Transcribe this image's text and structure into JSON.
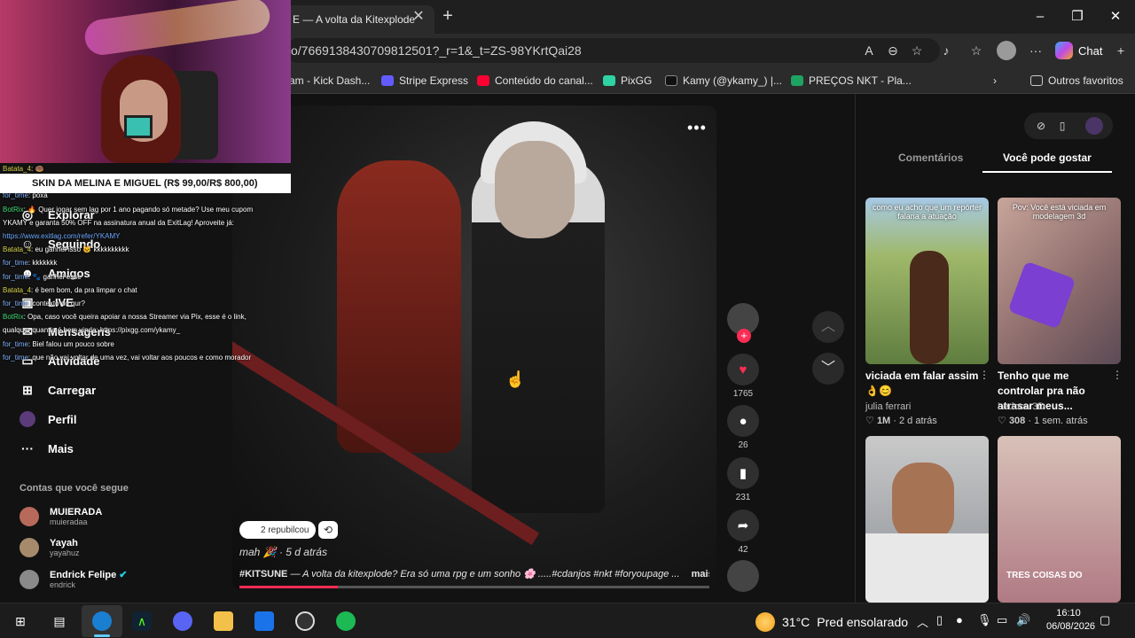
{
  "browser": {
    "tab_title": "E — A volta da Kitexplode",
    "tab_close": "✕",
    "new_tab": "+",
    "address": "o/7669138430709812501?_r=1&_t=ZS-98YKrtQai28",
    "chat_label": "Chat",
    "bookmarks": [
      "am - Kick Dash...",
      "Stripe Express",
      "Conteúdo do canal...",
      "PixGG",
      "Kamy (@ykamy_) |...",
      "PREÇOS NKT - Pla..."
    ],
    "other_favorites": "Outros favoritos",
    "colors": {
      "bar": "#2b2b2b",
      "tab_bar": "#1f1f1f"
    }
  },
  "sidebar": {
    "items": [
      {
        "label": "Explorar",
        "icon": "compass-icon"
      },
      {
        "label": "Seguindo",
        "icon": "following-icon"
      },
      {
        "label": "Amigos",
        "icon": "friends-icon"
      },
      {
        "label": "LIVE",
        "icon": "live-icon"
      },
      {
        "label": "Mensagens",
        "icon": "messages-icon"
      },
      {
        "label": "Atividade",
        "icon": "activity-icon"
      },
      {
        "label": "Carregar",
        "icon": "upload-icon"
      },
      {
        "label": "Perfil",
        "icon": "profile-icon"
      },
      {
        "label": "Mais",
        "icon": "more-icon"
      }
    ],
    "following_header": "Contas que você segue",
    "accounts": [
      {
        "name": "MUIERADA",
        "handle": "muieradaa"
      },
      {
        "name": "Yayah",
        "handle": "yayahuz"
      },
      {
        "name": "Endrick Felipe",
        "handle": "endrick"
      }
    ]
  },
  "video": {
    "repost_text": "2 repubilcou",
    "author": "mah 🎉 · 5 d atrás",
    "caption_bold": "#KITSUNE",
    "caption": " — A volta da kitexplode? Era só uma rpg e um sonho 🌸 .....#cdanjos #nkt #foryoupage ...",
    "more_label": "mais",
    "progress": 0.21,
    "likes": "1765",
    "comments": "26",
    "saves": "231",
    "shares": "42"
  },
  "right_panel": {
    "tabs": [
      "Comentários",
      "Você pode gostar"
    ],
    "active_tab": "Você pode gostar",
    "cards": [
      {
        "overlay": "como eu acho que um repórter falaria a atuação",
        "title": "viciada em falar assim 👌😊",
        "author": "julia ferrari",
        "likes": "1M",
        "time": "2 d atrás",
        "bg": "#5f7d3f"
      },
      {
        "overlay": "Pov: Você está viciada em modelagem 3d",
        "title": "Tenho que me controlar pra não atrasar meus...",
        "author": "Ledoca 3D",
        "likes": "308",
        "time": "1 sem. atrás",
        "bg": "#8a6a6a"
      },
      {
        "overlay": "",
        "title": "",
        "author": "",
        "likes": "",
        "time": "",
        "bg": "#8a8f96"
      },
      {
        "overlay": "TRES COISAS DO",
        "title": "",
        "author": "",
        "likes": "",
        "time": "",
        "bg": "#b07a84"
      }
    ]
  },
  "stream": {
    "banner": "SKIN DA MELINA E MIGUEL (R$ 99,00/R$ 800,00)",
    "chat": [
      {
        "user": "Batata_4",
        "text": ": 🍩",
        "color": "g"
      },
      {
        "user": "for_time",
        "text": ": figurinha*",
        "color": "b"
      },
      {
        "user": "for_time",
        "text": ": poxa",
        "color": "b"
      },
      {
        "user": "BotRix",
        "text": ": 🔥 Quer jogar sem lag por 1 ano pagando só metade? Use meu cupom",
        "color": "gr"
      },
      {
        "user": "",
        "text": "YKAMY e garanta 50% OFF na assinatura anual da ExitLag! Aproveite já:",
        "color": ""
      },
      {
        "user": "",
        "text": "https://www.exitlag.com/refer/YKAMY",
        "color": "link"
      },
      {
        "user": "Batata_4",
        "text": ": eu ganhei isso 😺 kkkkkkkkkk",
        "color": "g"
      },
      {
        "user": "for_time",
        "text": ": kkkkkkk",
        "color": "b"
      },
      {
        "user": "for_time",
        "text": ": 🐾 ganhei esse",
        "color": "b"
      },
      {
        "user": "Batata_4",
        "text": ": é bem bom, da pra limpar o chat",
        "color": "g"
      },
      {
        "user": "for_time",
        "text": ": contexto do qur?",
        "color": "b"
      },
      {
        "user": "BotRix",
        "text": ": Opa, caso você queira apoiar a nossa Streamer via Pix, esse é o link,",
        "color": "gr"
      },
      {
        "user": "",
        "text": "qualquer quantia é bem vinda: https://pixgg.com/ykamy_",
        "color": ""
      },
      {
        "user": "for_time",
        "text": ": Biel falou um pouco sobre",
        "color": "b"
      },
      {
        "user": "for_time",
        "text": ": que não vai voltar de uma vez, vai voltar aos poucos e como morador",
        "color": "b"
      }
    ]
  },
  "taskbar": {
    "temp": "31°C",
    "weather": "Pred ensolarado",
    "time": "16:10",
    "date": "06/08/2026"
  }
}
